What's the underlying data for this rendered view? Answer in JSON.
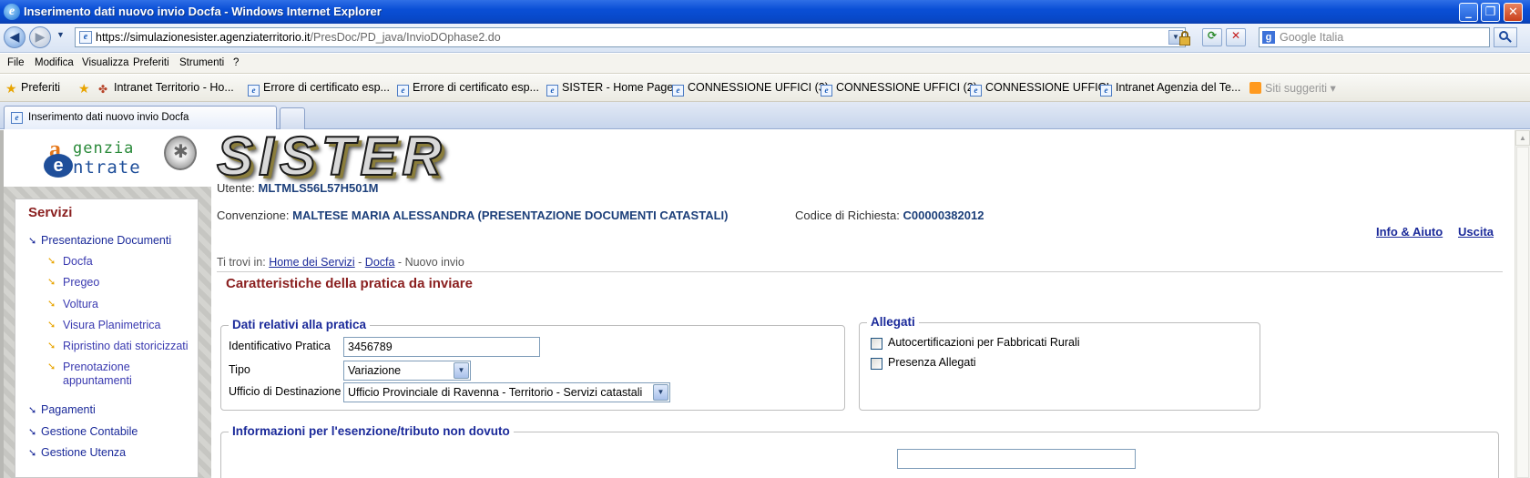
{
  "window": {
    "title": "Inserimento dati nuovo invio Docfa - Windows Internet Explorer",
    "buttons": {
      "minimize": "_",
      "maximize": "❐",
      "close": "✕"
    }
  },
  "address": {
    "url_host": "https://simulazionesister.agenziaterritorio.it",
    "url_path": "/PresDoc/PD_java/InvioDOphase2.do",
    "search_placeholder": "Google Italia"
  },
  "menu": [
    "File",
    "Modifica",
    "Visualizza",
    "Preferiti",
    "Strumenti",
    "?"
  ],
  "favorites": {
    "label": "Preferiti",
    "items": [
      "Intranet Territorio - Ho...",
      "Errore di certificato esp...",
      "Errore di certificato esp...",
      "SISTER - Home Page",
      "CONNESSIONE UFFICI (3)",
      "CONNESSIONE UFFICI (2)",
      "CONNESSIONE UFFICI",
      "Intranet Agenzia del Te..."
    ],
    "suggested": "Siti suggeriti ▾"
  },
  "tab": {
    "label": "Inserimento dati nuovo invio Docfa"
  },
  "logo": {
    "line1": "genzia",
    "line2": "ntrate"
  },
  "banner": "SISTER",
  "sidebar": {
    "header": "Servizi",
    "presentazione": "Presentazione Documenti",
    "sub": [
      "Docfa",
      "Pregeo",
      "Voltura",
      "Visura Planimetrica",
      "Ripristino dati storicizzati",
      "Prenotazione appuntamenti"
    ],
    "pagamenti": "Pagamenti",
    "contabile": "Gestione Contabile",
    "utenza": "Gestione Utenza"
  },
  "header": {
    "utente_label": "Utente:",
    "utente_value": "MLTMLS56L57H501M",
    "convenzione_label": "Convenzione:",
    "convenzione_value": "MALTESE MARIA ALESSANDRA (PRESENTAZIONE DOCUMENTI CATASTALI)",
    "codice_label": "Codice di Richiesta:",
    "codice_value": "C00000382012",
    "info_link": "Info & Aiuto",
    "uscita_link": "Uscita"
  },
  "breadcrumb": {
    "prefix": "Ti trovi in:",
    "home": "Home dei Servizi",
    "sep": " - ",
    "docfa": "Docfa",
    "current": "Nuovo invio"
  },
  "page_title": "Caratteristiche della pratica da inviare",
  "pratica": {
    "legend": "Dati relativi alla pratica",
    "id_label": "Identificativo Pratica",
    "id_value": "3456789",
    "tipo_label": "Tipo",
    "tipo_value": "Variazione",
    "ufficio_label": "Ufficio di Destinazione",
    "ufficio_value": "Ufficio Provinciale di Ravenna - Territorio - Servizi catastali"
  },
  "allegati": {
    "legend": "Allegati",
    "opt1": "Autocertificazioni per Fabbricati Rurali",
    "opt2": "Presenza Allegati"
  },
  "esenzione": {
    "legend": "Informazioni per l'esenzione/tributo non dovuto"
  }
}
